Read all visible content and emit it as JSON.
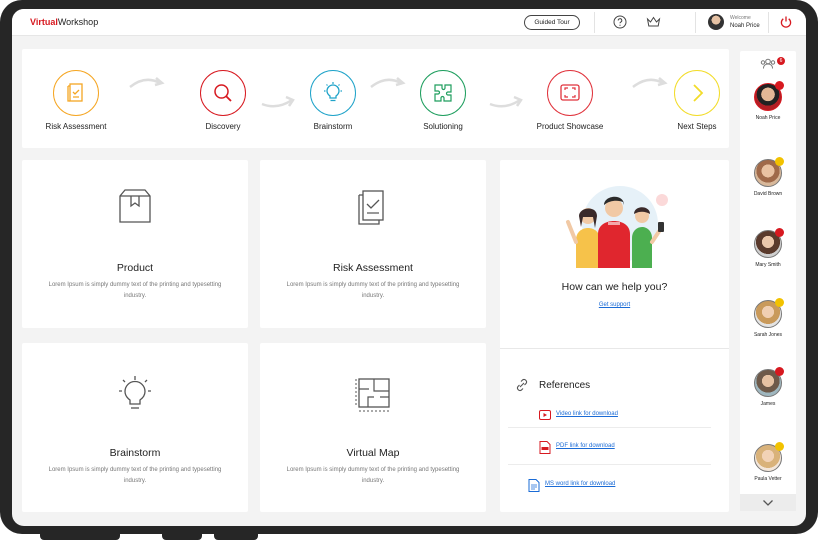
{
  "header": {
    "brand_red": "Virtual",
    "brand_black": "Workshop",
    "guided_tour": "Guided Tour",
    "welcome": "Welcome",
    "user_name": "Noah Price"
  },
  "flow": {
    "steps": [
      {
        "label": "Risk Assessment",
        "icon": "document-check-icon",
        "color": "#f5a623"
      },
      {
        "label": "Discovery",
        "icon": "search-icon",
        "color": "#d71920"
      },
      {
        "label": "Brainstorm",
        "icon": "lightbulb-icon",
        "color": "#1fa3c9"
      },
      {
        "label": "Solutioning",
        "icon": "puzzle-icon",
        "color": "#1e9e5e"
      },
      {
        "label": "Product Showcase",
        "icon": "screen-icon",
        "color": "#e0333c"
      },
      {
        "label": "Next Steps",
        "icon": "chevron-right-icon",
        "color": "#f2dc2a"
      }
    ]
  },
  "cards": [
    {
      "title": "Product",
      "desc": "Lorem Ipsum is simply dummy text of the printing and typesetting industry.",
      "icon": "box-icon"
    },
    {
      "title": "Risk Assessment",
      "desc": "Lorem Ipsum is simply dummy text of the printing and typesetting industry.",
      "icon": "document-check-icon"
    },
    {
      "title": "Brainstorm",
      "desc": "Lorem Ipsum is simply dummy text of the printing and typesetting industry.",
      "icon": "lightbulb-icon"
    },
    {
      "title": "Virtual Map",
      "desc": "Lorem Ipsum is simply dummy text of the printing and typesetting industry.",
      "icon": "floorplan-icon"
    }
  ],
  "help": {
    "title": "How can we help you?",
    "support_link": "Get support",
    "references_title": "References",
    "references": [
      {
        "label": "Video link for download",
        "icon": "video-icon"
      },
      {
        "label": "PDF link for download",
        "icon": "pdf-icon"
      },
      {
        "label": "MS word link for download",
        "icon": "word-icon"
      }
    ]
  },
  "participants": {
    "count_badge": "6",
    "list": [
      {
        "name": "Noah Price",
        "badge": "red"
      },
      {
        "name": "David Brown",
        "badge": "crown"
      },
      {
        "name": "Mary Smith",
        "badge": "red"
      },
      {
        "name": "Sarah Jones",
        "badge": "crown"
      },
      {
        "name": "James",
        "badge": "red"
      },
      {
        "name": "Paula Vetter",
        "badge": "crown"
      }
    ]
  },
  "colors": {
    "accent": "#d71920",
    "link": "#1a6bd6",
    "crown": "#f2c200"
  }
}
